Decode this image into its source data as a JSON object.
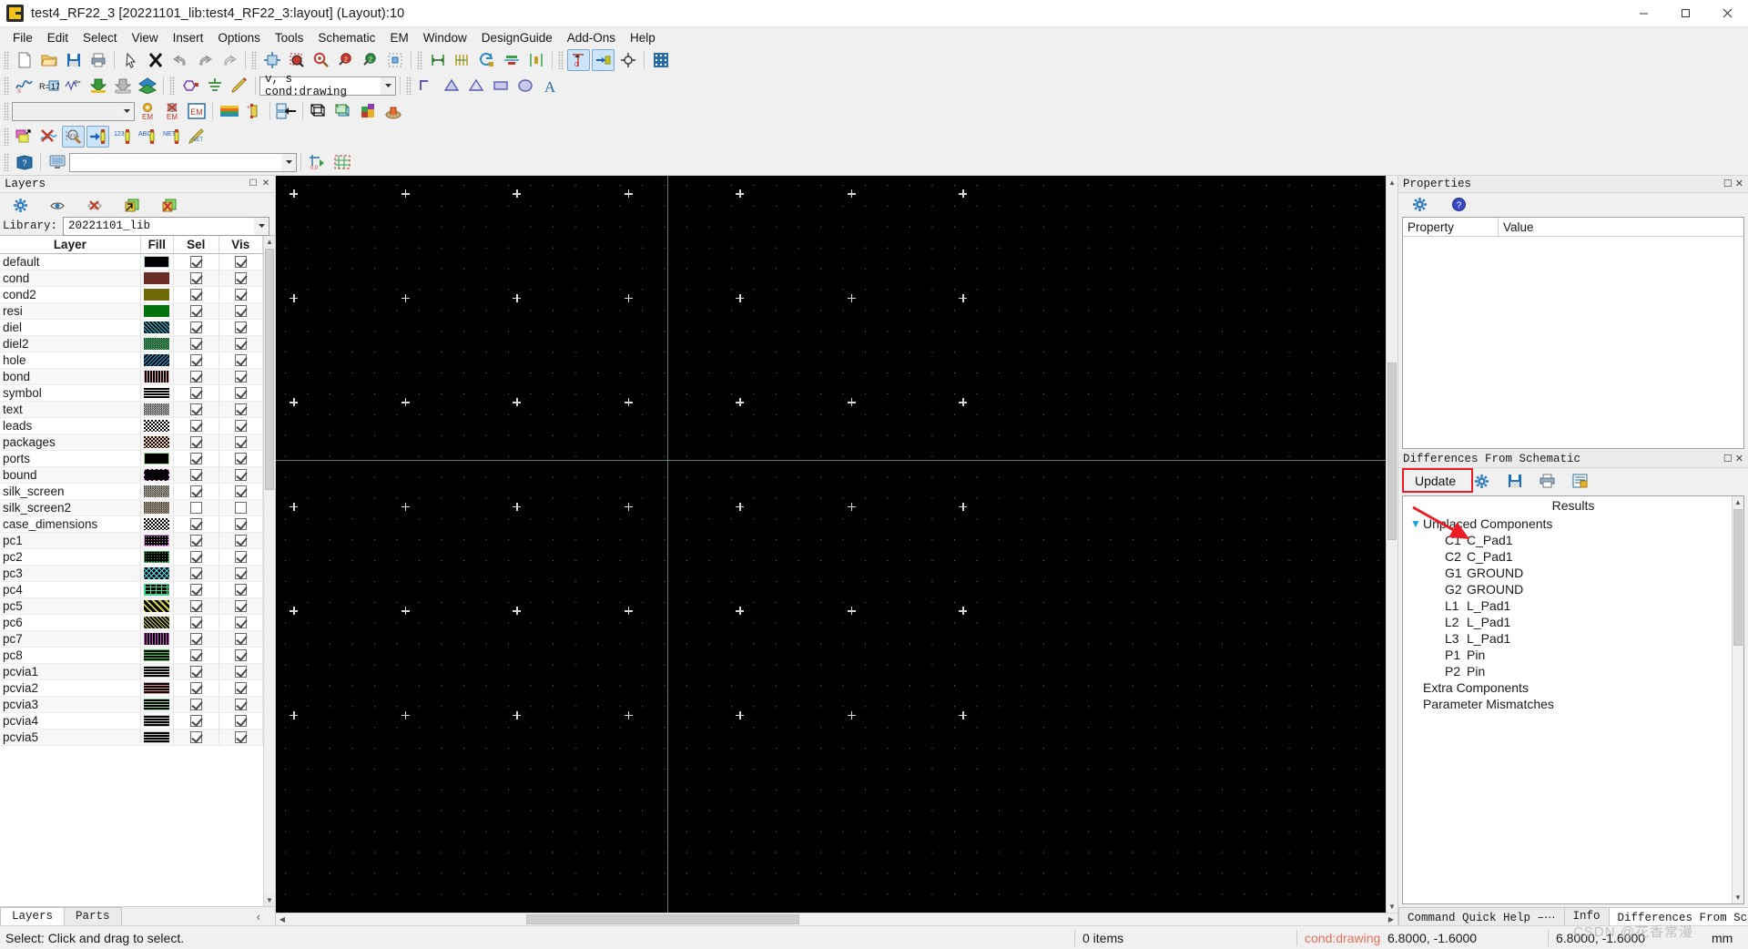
{
  "window": {
    "title": "test4_RF22_3 [20221101_lib:test4_RF22_3:layout] (Layout):10",
    "minimize_label": "–",
    "maximize_label": "❐",
    "close_label": "✕"
  },
  "menubar": {
    "items": [
      "File",
      "Edit",
      "Select",
      "View",
      "Insert",
      "Options",
      "Tools",
      "Schematic",
      "EM",
      "Window",
      "DesignGuide",
      "Add-Ons",
      "Help"
    ]
  },
  "toolbar": {
    "row1": [
      {
        "name": "new-icon",
        "tip": "New"
      },
      {
        "name": "open-folder-icon",
        "tip": "Open"
      },
      {
        "name": "save-icon",
        "tip": "Save"
      },
      {
        "name": "print-icon",
        "tip": "Print"
      },
      {
        "name": "select-arrow-icon",
        "tip": "Select"
      },
      {
        "name": "delete-x-icon",
        "tip": "Delete"
      },
      {
        "name": "undo-icon",
        "tip": "Undo"
      },
      {
        "name": "redo-icon",
        "tip": "Redo"
      },
      {
        "name": "redo-all-icon",
        "tip": "Redo all"
      },
      {
        "name": "zoom-fit-icon",
        "tip": "View All"
      },
      {
        "name": "zoom-area-icon",
        "tip": "Zoom Area"
      },
      {
        "name": "zoom-in-icon",
        "tip": "Zoom In"
      },
      {
        "name": "zoom-in-2x-icon",
        "tip": "Zoom In 2x"
      },
      {
        "name": "zoom-out-2x-icon",
        "tip": "Zoom Out 2x"
      },
      {
        "name": "zoom-selection-icon",
        "tip": "Zoom to selection"
      },
      {
        "name": "ruler-single-icon",
        "tip": "Measure"
      },
      {
        "name": "ruler-multi-icon",
        "tip": "Measure multiple"
      },
      {
        "name": "rotate-icon",
        "tip": "Rotate"
      },
      {
        "name": "align-icon",
        "tip": "Align"
      },
      {
        "name": "distribute-icon",
        "tip": "Distribute"
      },
      {
        "name": "origin-snap-icon",
        "tip": "Set origin"
      },
      {
        "name": "pin-snap-icon",
        "tip": "Snap pin"
      },
      {
        "name": "node-snap-icon",
        "tip": "Snap node"
      },
      {
        "name": "grid-toggle-icon",
        "tip": "Grid"
      }
    ],
    "row2": [
      {
        "name": "sparam-icon",
        "tip": "S-parameter"
      },
      {
        "name": "resistor-calc-icon",
        "tip": "R calc"
      },
      {
        "name": "via-down-icon",
        "tip": "Via down"
      },
      {
        "name": "via-up-icon",
        "tip": "Via up"
      },
      {
        "name": "substrate-icon",
        "tip": "Substrate"
      },
      {
        "name": "port-icon",
        "tip": "Port"
      },
      {
        "name": "ground-icon",
        "tip": "Ground"
      },
      {
        "name": "pencil-icon",
        "tip": "Edit"
      },
      {
        "name": "polyline-icon",
        "tip": "Polyline"
      },
      {
        "name": "polygon-icon",
        "tip": "Polygon"
      },
      {
        "name": "path-icon",
        "tip": "Path"
      },
      {
        "name": "rectangle-icon",
        "tip": "Rectangle"
      },
      {
        "name": "circle-icon",
        "tip": "Circle"
      },
      {
        "name": "text-tool-icon",
        "tip": "Text"
      }
    ],
    "row3": [
      {
        "name": "em-setup-icon",
        "tip": "EM Setup"
      },
      {
        "name": "em-stop-icon",
        "tip": "EM Stop"
      },
      {
        "name": "em-window-icon",
        "tip": "EM Window"
      },
      {
        "name": "substrate-editor-icon",
        "tip": "Substrate Editor"
      },
      {
        "name": "port-editor-icon",
        "tip": "Port Editor"
      },
      {
        "name": "em-model-icon",
        "tip": "EM Model"
      },
      {
        "name": "3d-wire-icon",
        "tip": "3D Wireframe"
      },
      {
        "name": "3d-solid-icon",
        "tip": "3D Solid"
      },
      {
        "name": "3d-layers-icon",
        "tip": "3D Layers"
      },
      {
        "name": "3d-preview-icon",
        "tip": "3D Preview"
      }
    ],
    "row4": [
      {
        "name": "layer-copy-icon",
        "tip": "Copy layer"
      },
      {
        "name": "clear-net-icon",
        "tip": "Clear net"
      },
      {
        "name": "probe-icon",
        "tip": "Probe"
      },
      {
        "name": "insert-pin-icon",
        "tip": "Insert pin"
      },
      {
        "name": "pin-number-icon",
        "tip": "Pin number"
      },
      {
        "name": "pin-name-icon",
        "tip": "Pin name"
      },
      {
        "name": "net-name-icon",
        "tip": "Net name"
      },
      {
        "name": "net-edit-icon",
        "tip": "Net edit"
      }
    ],
    "row5": [
      {
        "name": "help-book-icon",
        "tip": "Help"
      },
      {
        "name": "monitor-icon",
        "tip": "Display"
      },
      {
        "name": "origin-marker-icon",
        "tip": "Origin"
      },
      {
        "name": "snap-grid-icon",
        "tip": "Snap grid"
      }
    ],
    "layer_combo_value": "v, s  cond:drawing",
    "component_combo_value": "",
    "search_value": ""
  },
  "layers_panel": {
    "title": "Layers",
    "tools": [
      "layer-settings-icon",
      "show-all-icon",
      "hide-all-icon",
      "select-all-icon",
      "deselect-all-icon"
    ],
    "library_label": "Library:",
    "library_value": "20221101_lib",
    "columns": [
      "Layer",
      "Fill",
      "Sel",
      "Vis"
    ],
    "rows": [
      {
        "name": "default",
        "fill": "#000000",
        "pattern": "solid-outline",
        "outline": "#b8cfe0",
        "sel": true,
        "vis": true
      },
      {
        "name": "cond",
        "fill": "#6b2f28",
        "pattern": "solid",
        "sel": true,
        "vis": true
      },
      {
        "name": "cond2",
        "fill": "#6e6a08",
        "pattern": "solid",
        "sel": true,
        "vis": true
      },
      {
        "name": "resi",
        "fill": "#00730c",
        "pattern": "solid",
        "sel": true,
        "vis": true
      },
      {
        "name": "diel",
        "fill": "#1fd0e8",
        "pattern": "diag-dense",
        "sel": true,
        "vis": true
      },
      {
        "name": "diel2",
        "fill": "#4fd07a",
        "pattern": "checker-fine",
        "sel": true,
        "vis": true
      },
      {
        "name": "hole",
        "fill": "#2aa8e8",
        "pattern": "diag-rev",
        "sel": true,
        "vis": true
      },
      {
        "name": "bond",
        "fill": "#f2a8b8",
        "pattern": "vstripe",
        "sel": true,
        "vis": true
      },
      {
        "name": "symbol",
        "fill": "#ffffff",
        "pattern": "hstripe",
        "sel": true,
        "vis": true
      },
      {
        "name": "text",
        "fill": "#e8e8e8",
        "pattern": "checker-fine",
        "sel": true,
        "vis": true
      },
      {
        "name": "leads",
        "fill": "#ffffff",
        "pattern": "checker",
        "sel": true,
        "vis": true
      },
      {
        "name": "packages",
        "fill": "#f2cf8a",
        "pattern": "checker",
        "sel": true,
        "vis": true
      },
      {
        "name": "ports",
        "fill": "#000000",
        "pattern": "outline",
        "outline": "#8fe09a",
        "sel": true,
        "vis": true
      },
      {
        "name": "bound",
        "fill": "#000000",
        "pattern": "dash-outline",
        "outline": "#e89ae8",
        "sel": true,
        "vis": true
      },
      {
        "name": "silk_screen",
        "fill": "#e0d8c8",
        "pattern": "checker-fine",
        "sel": true,
        "vis": true
      },
      {
        "name": "silk_screen2",
        "fill": "#d8c8b0",
        "pattern": "checker-fine",
        "sel": false,
        "vis": false
      },
      {
        "name": "case_dimensions",
        "fill": "#ffffff",
        "pattern": "checker",
        "sel": true,
        "vis": true
      },
      {
        "name": "pc1",
        "fill": "#e09ae8",
        "pattern": "dot-box",
        "sel": true,
        "vis": true
      },
      {
        "name": "pc2",
        "fill": "#3aa85a",
        "pattern": "dot-box",
        "sel": true,
        "vis": true
      },
      {
        "name": "pc3",
        "fill": "#55d8ea",
        "pattern": "crosshatch",
        "sel": true,
        "vis": true
      },
      {
        "name": "pc4",
        "fill": "#3ad88a",
        "pattern": "brick",
        "sel": true,
        "vis": true
      },
      {
        "name": "pc5",
        "fill": "#d8d84a",
        "pattern": "diag-wide",
        "sel": true,
        "vis": true
      },
      {
        "name": "pc6",
        "fill": "#d8d84a",
        "pattern": "diag-dense",
        "sel": true,
        "vis": true
      },
      {
        "name": "pc7",
        "fill": "#d84ad8",
        "pattern": "vstripe",
        "sel": true,
        "vis": true
      },
      {
        "name": "pc8",
        "fill": "#3ad84a",
        "pattern": "hstripe",
        "sel": true,
        "vis": true
      },
      {
        "name": "pcvia1",
        "fill": "#d8d8d8",
        "pattern": "hstripe",
        "sel": true,
        "vis": true
      },
      {
        "name": "pcvia2",
        "fill": "#e08a8a",
        "pattern": "hstripe",
        "sel": true,
        "vis": true
      },
      {
        "name": "pcvia3",
        "fill": "#8ad8a0",
        "pattern": "hstripe",
        "sel": true,
        "vis": true
      },
      {
        "name": "pcvia4",
        "fill": "#c8c8c8",
        "pattern": "hstripe",
        "sel": true,
        "vis": true
      },
      {
        "name": "pcvia5",
        "fill": "#c8c8c8",
        "pattern": "hstripe",
        "sel": true,
        "vis": true
      }
    ],
    "tabs": [
      {
        "label": "Layers",
        "active": true
      },
      {
        "label": "Parts",
        "active": false
      }
    ],
    "collapse_chevron": "‹"
  },
  "properties_panel": {
    "title": "Properties",
    "tools": [
      "gear-icon",
      "help-icon"
    ],
    "columns": [
      "Property",
      "Value"
    ],
    "rows": []
  },
  "differences_panel": {
    "title": "Differences From Schematic",
    "update_label": "Update",
    "tools": [
      "gear-icon",
      "save-icon",
      "print-icon",
      "export-icon"
    ],
    "results_header": "Results",
    "tree": [
      {
        "level": 1,
        "chevron": "⌄",
        "label": "Unplaced Components"
      },
      {
        "level": 2,
        "id": "C1",
        "label": "C_Pad1"
      },
      {
        "level": 2,
        "id": "C2",
        "label": "C_Pad1"
      },
      {
        "level": 2,
        "id": "G1",
        "label": "GROUND"
      },
      {
        "level": 2,
        "id": "G2",
        "label": "GROUND"
      },
      {
        "level": 2,
        "id": "L1",
        "label": "L_Pad1"
      },
      {
        "level": 2,
        "id": "L2",
        "label": "L_Pad1"
      },
      {
        "level": 2,
        "id": "L3",
        "label": "L_Pad1"
      },
      {
        "level": 2,
        "id": "P1",
        "label": "Pin"
      },
      {
        "level": 2,
        "id": "P2",
        "label": "Pin"
      },
      {
        "level": 1,
        "label": "Extra Components"
      },
      {
        "level": 1,
        "label": "Parameter Mismatches"
      }
    ],
    "tabs": [
      {
        "label": "Command Quick Help –⋯",
        "active": false
      },
      {
        "label": "Info",
        "active": false
      },
      {
        "label": "Differences From Sc⋯",
        "active": true
      }
    ]
  },
  "statusbar": {
    "message": "Select: Click and drag to select.",
    "items_count": "0 items",
    "active_layer": "cond:drawing",
    "coord1": "6.8000, -1.6000",
    "coord2": "6.8000, -1.6000",
    "units": "mm",
    "watermark": "CSDN @花香常漫"
  },
  "colors": {
    "accent_red": "#ee1c25",
    "canvas_bg": "#000000",
    "panel_bg": "#f0f0f0",
    "layer_text": "#e8705a"
  }
}
